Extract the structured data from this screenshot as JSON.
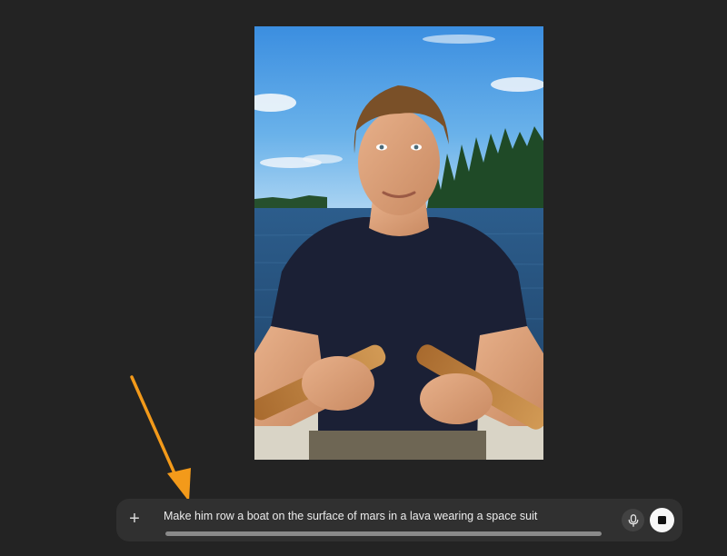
{
  "image": {
    "alt": "",
    "icon": "photo"
  },
  "annotation": {
    "icon": "arrow-down-left-icon",
    "color": "#F39A1A"
  },
  "composer": {
    "plus_label": "+",
    "plus_icon": "plus-icon",
    "prompt_text": "Make him row a boat on the surface of mars in a lava wearing a space suit",
    "progress_fraction": 1.0,
    "mic_icon": "microphone-icon",
    "stop_icon": "stop-icon"
  },
  "colors": {
    "background": "#232323",
    "composer_bg": "#303030",
    "text": "#ECECEC",
    "accent_arrow": "#F39A1A",
    "stop_button_bg": "#F7F7F7"
  }
}
